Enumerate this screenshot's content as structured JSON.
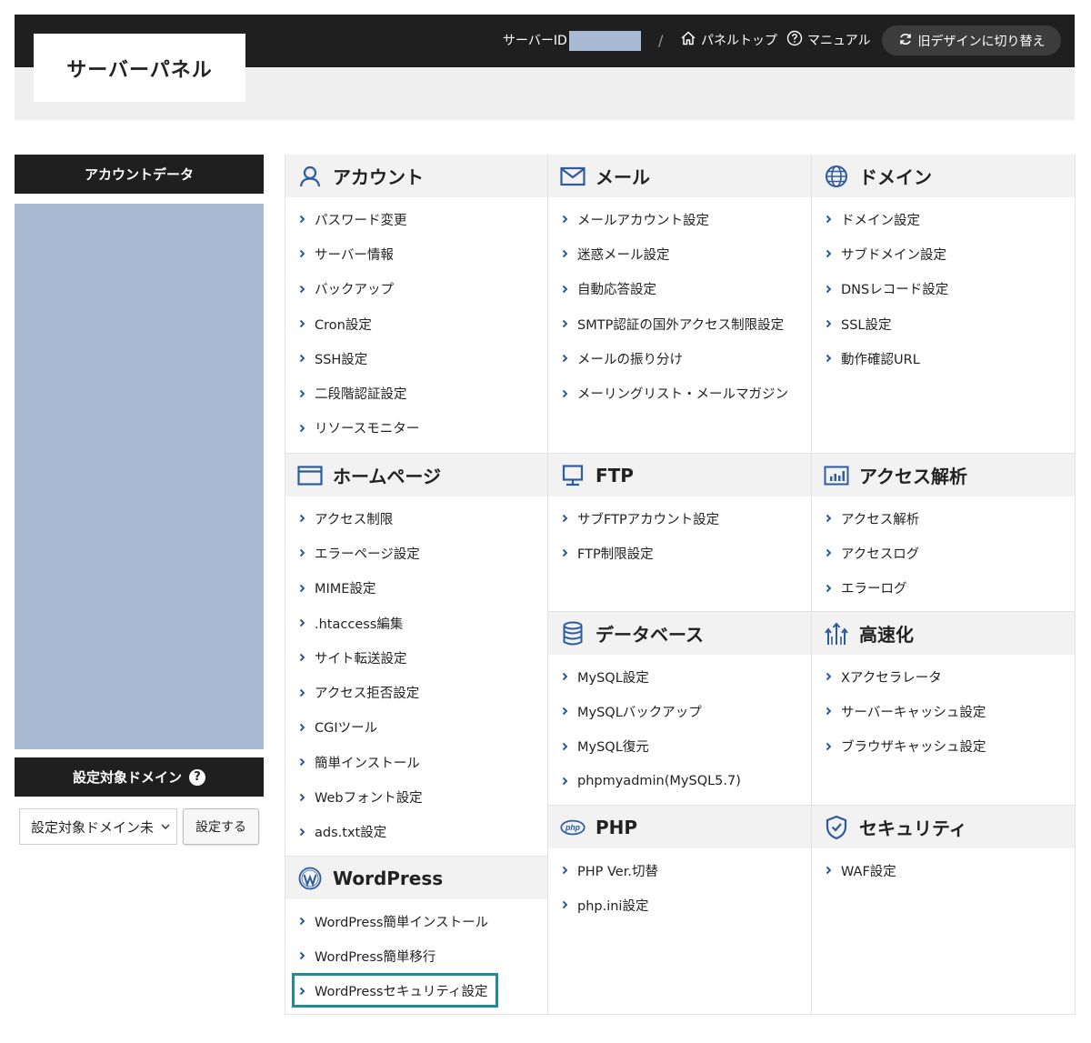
{
  "header": {
    "logo": "サーバーパネル",
    "server_id_label": "サーバーID",
    "separator": "/",
    "panel_top": "パネルトップ",
    "manual": "マニュアル",
    "old_design": "旧デザインに切り替え"
  },
  "sidebar": {
    "account_title": "アカウントデータ",
    "domain_title": "設定対象ドメイン",
    "help_icon": "?",
    "domain_select_value": "設定対象ドメイン未",
    "set_button": "設定する"
  },
  "sections": {
    "account": {
      "title": "アカウント",
      "icon": "user-icon",
      "items": [
        "パスワード変更",
        "サーバー情報",
        "バックアップ",
        "Cron設定",
        "SSH設定",
        "二段階認証設定",
        "リソースモニター"
      ]
    },
    "mail": {
      "title": "メール",
      "icon": "envelope-icon",
      "items": [
        "メールアカウント設定",
        "迷惑メール設定",
        "自動応答設定",
        "SMTP認証の国外アクセス制限設定",
        "メールの振り分け",
        "メーリングリスト・メールマガジン"
      ]
    },
    "domain": {
      "title": "ドメイン",
      "icon": "globe-icon",
      "items": [
        "ドメイン設定",
        "サブドメイン設定",
        "DNSレコード設定",
        "SSL設定",
        "動作確認URL"
      ]
    },
    "homepage": {
      "title": "ホームページ",
      "icon": "browser-window-icon",
      "items": [
        "アクセス制限",
        "エラーページ設定",
        "MIME設定",
        ".htaccess編集",
        "サイト転送設定",
        "アクセス拒否設定",
        "CGIツール",
        "簡単インストール",
        "Webフォント設定",
        "ads.txt設定"
      ]
    },
    "ftp": {
      "title": "FTP",
      "icon": "monitor-icon",
      "items": [
        "サブFTPアカウント設定",
        "FTP制限設定"
      ]
    },
    "analytics": {
      "title": "アクセス解析",
      "icon": "bar-chart-icon",
      "items": [
        "アクセス解析",
        "アクセスログ",
        "エラーログ"
      ]
    },
    "database": {
      "title": "データベース",
      "icon": "database-icon",
      "items": [
        "MySQL設定",
        "MySQLバックアップ",
        "MySQL復元",
        "phpmyadmin(MySQL5.7)"
      ]
    },
    "speed": {
      "title": "高速化",
      "icon": "speed-arrows-icon",
      "items": [
        "Xアクセラレータ",
        "サーバーキャッシュ設定",
        "ブラウザキャッシュ設定"
      ]
    },
    "wordpress": {
      "title": "WordPress",
      "icon": "wordpress-icon",
      "items": [
        "WordPress簡単インストール",
        "WordPress簡単移行",
        "WordPressセキュリティ設定"
      ]
    },
    "php": {
      "title": "PHP",
      "icon": "php-icon",
      "icon_text": "php",
      "items": [
        "PHP Ver.切替",
        "php.ini設定"
      ]
    },
    "security": {
      "title": "セキュリティ",
      "icon": "shield-check-icon",
      "items": [
        "WAF設定"
      ]
    }
  },
  "colors": {
    "accent_blue": "#2d5c9e",
    "header_dark": "#1f1f1f",
    "highlight": "#1a8f95",
    "mask": "#a9bad3"
  }
}
